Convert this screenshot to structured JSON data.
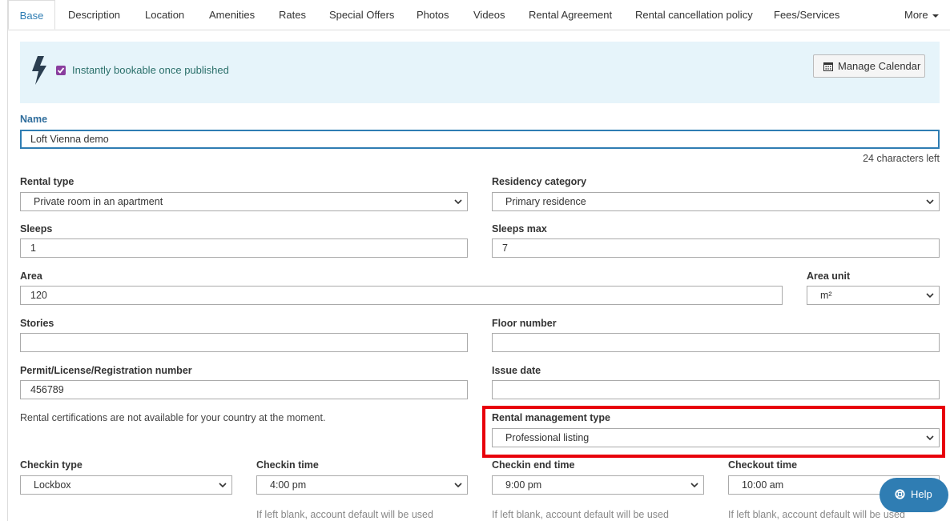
{
  "tabs": [
    {
      "label": "Base"
    },
    {
      "label": "Description"
    },
    {
      "label": "Location"
    },
    {
      "label": "Amenities"
    },
    {
      "label": "Rates"
    },
    {
      "label": "Special Offers"
    },
    {
      "label": "Photos"
    },
    {
      "label": "Videos"
    },
    {
      "label": "Rental Agreement"
    },
    {
      "label": "Rental cancellation policy"
    },
    {
      "label": "Fees/Services"
    },
    {
      "label": "More"
    }
  ],
  "banner": {
    "checkbox_label": "Instantly bookable once published",
    "checkbox_checked": true,
    "manage_calendar_label": "Manage Calendar"
  },
  "form": {
    "name": {
      "label": "Name",
      "value": "Loft Vienna demo",
      "chars_left": "24 characters left"
    },
    "rental_type": {
      "label": "Rental type",
      "value": "Private room in an apartment"
    },
    "residency_category": {
      "label": "Residency category",
      "value": "Primary residence"
    },
    "sleeps": {
      "label": "Sleeps",
      "value": "1"
    },
    "sleeps_max": {
      "label": "Sleeps max",
      "value": "7"
    },
    "area": {
      "label": "Area",
      "value": "120"
    },
    "area_unit": {
      "label": "Area unit",
      "value": "m²"
    },
    "stories": {
      "label": "Stories",
      "value": ""
    },
    "floor_number": {
      "label": "Floor number",
      "value": ""
    },
    "permit": {
      "label": "Permit/License/Registration number",
      "value": "456789"
    },
    "issue_date": {
      "label": "Issue date",
      "value": ""
    },
    "certifications_note": "Rental certifications are not available for your country at the moment.",
    "management_type": {
      "label": "Rental management type",
      "value": "Professional listing"
    },
    "checkin_type": {
      "label": "Checkin type",
      "value": "Lockbox"
    },
    "checkin_time": {
      "label": "Checkin time",
      "value": "4:00 pm",
      "hint": "If left blank, account default will be used"
    },
    "checkin_end_time": {
      "label": "Checkin end time",
      "value": "9:00 pm",
      "hint": "If left blank, account default will be used"
    },
    "checkout_time": {
      "label": "Checkout time",
      "value": "10:00 am",
      "hint": "If left blank, account default will be used"
    }
  },
  "help": {
    "label": "Help"
  },
  "colors": {
    "accent": "#2f7db3",
    "banner_bg": "#e6f4fa",
    "checkbox": "#8a3d9e",
    "highlight": "#e8000b"
  }
}
